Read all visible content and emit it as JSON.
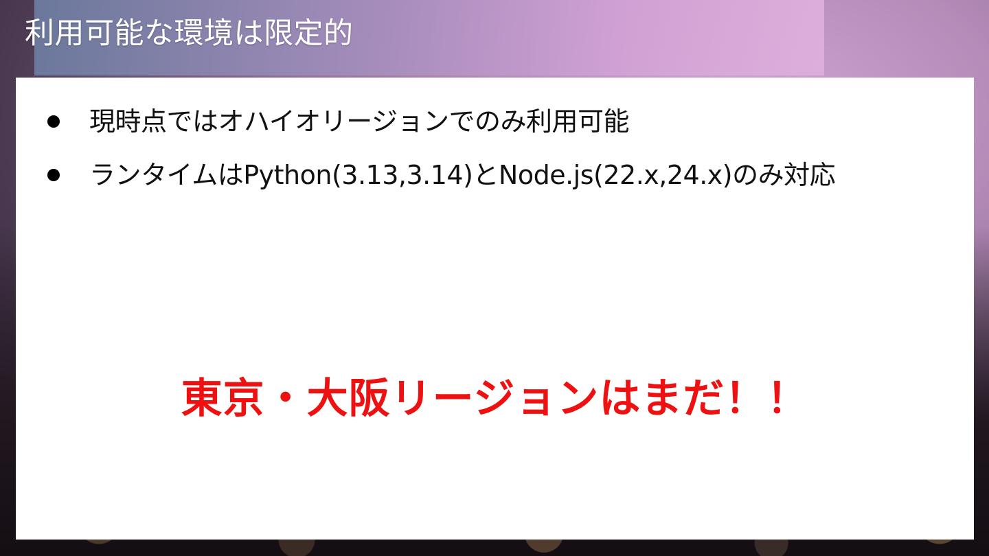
{
  "slide": {
    "title": "利用可能な環境は限定的",
    "bullets": [
      {
        "text": "現時点ではオハイオリージョンでのみ利用可能"
      },
      {
        "text": "ランタイムはPython(3.13,3.14)とNode.js(22.x,24.x)のみ対応"
      }
    ],
    "highlight": "東京・大阪リージョンはまだ！！"
  },
  "colors": {
    "title_text": "#ffffff",
    "panel_background": "#ffffff",
    "body_text": "#111111",
    "highlight_text": "#ee1111"
  }
}
